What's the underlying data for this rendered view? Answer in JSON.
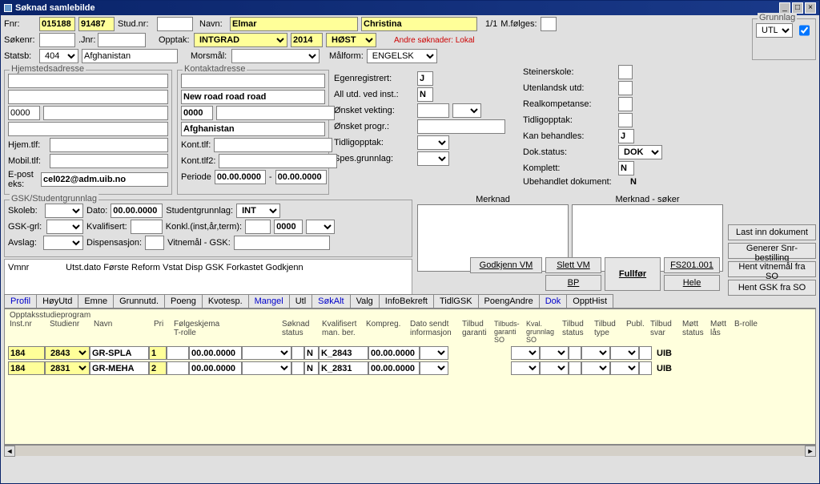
{
  "window_title": "Søknad samlebilde",
  "header": {
    "fnr_label": "Fnr:",
    "fnr1": "015188",
    "fnr2": "91487",
    "studnr_label": "Stud.nr:",
    "studnr": "",
    "navn_label": "Navn:",
    "navn_first": "Elmar",
    "navn_last": "Christina",
    "count": "1/1",
    "mfolges_label": "M.følges:",
    "mfolges": "",
    "sokenr_label": "Søkenr:",
    "sokenr": "",
    "jnr_label": ".Jnr:",
    "jnr": "",
    "opptak_label": "Opptak:",
    "opptak": "INTGRAD",
    "opptak_year": "2014",
    "opptak_sem": "HØST",
    "andre_soknader": "Andre søknader: Lokal",
    "statsb_label": "Statsb:",
    "statsb_code": "404",
    "statsb_name": "Afghanistan",
    "morsmal_label": "Morsmål:",
    "morsmal": "",
    "malform_label": "Målform:",
    "malform": "ENGELSK"
  },
  "grunnlag": {
    "title": "Grunnlag",
    "value": "UTL",
    "checked": true
  },
  "hjemsted": {
    "title": "Hjemstedsadresse",
    "line1": "",
    "line2": "",
    "zip": "0000",
    "city": "",
    "country": "",
    "hjemtlf_label": "Hjem.tlf:",
    "hjemtlf": "",
    "mobiltlf_label": "Mobil.tlf:",
    "mobiltlf": "",
    "epost_label": "E-post eks:",
    "epost": "cel022@adm.uib.no"
  },
  "kontakt": {
    "title": "Kontaktadresse",
    "line1": "",
    "line2": "New road road road",
    "zip": "0000",
    "city": "",
    "country": "Afghanistan",
    "konttlf_label": "Kont.tlf:",
    "konttlf": "",
    "konttlf2_label": "Kont.tlf2:",
    "konttlf2": "",
    "periode_label": "Periode",
    "periode_from": "00.00.0000",
    "periode_to": "00.00.0000"
  },
  "mid": {
    "egenregistrert_label": "Egenregistrert:",
    "egenregistrert": "J",
    "allutd_label": "All utd. ved inst.:",
    "allutd": "N",
    "onsket_vekting_label": "Ønsket vekting:",
    "onsket_vekting": "",
    "onsket_progr_label": "Ønsket progr.:",
    "onsket_progr": "",
    "tidligopptak_label": "Tidligopptak:",
    "tidligopptak": "",
    "spesgrunnlag_label": "Spes.grunnlag:",
    "spesgrunnlag": "",
    "steinerskole_label": "Steinerskole:",
    "steinerskole": "",
    "utenlandsk_label": "Utenlandsk utd:",
    "utenlandsk": "",
    "realkompetanse_label": "Realkompetanse:",
    "realkompetanse": "",
    "tidligopptak2_label": "Tidligopptak:",
    "tidligopptak2": "",
    "kanbehandles_label": "Kan behandles:",
    "kanbehandles": "J",
    "dokstatus_label": "Dok.status:",
    "dokstatus": "DOK",
    "komplett_label": "Komplett:",
    "komplett": "N",
    "ubehandlet_label": "Ubehandlet dokument:",
    "ubehandlet": "N"
  },
  "gsk": {
    "title": "GSK/Studentgrunnlag",
    "skoleb_label": "Skoleb:",
    "dato_label": "Dato:",
    "dato": "00.00.0000",
    "studentgrunnlag_label": "Studentgrunnlag:",
    "studentgrunnlag": "INT",
    "gskgrl_label": "GSK-grl:",
    "kvalifisert_label": "Kvalifisert:",
    "kvalifisert": "",
    "konkl_label": "Konkl.(inst,år,term):",
    "konkl_val": "0000",
    "avslag_label": "Avslag:",
    "dispensasjon_label": "Dispensasjon:",
    "dispensasjon": "",
    "vitnemal_label": "Vitnemål - GSK:"
  },
  "merknad_title": "Merknad",
  "merknad_soker_title": "Merknad - søker",
  "vmnr_header": "Vmnr               Utst.dato Første Reform Vstat Disp GSK Forkastet Godkjenn",
  "buttons": {
    "slett_vm": "Slett VM",
    "bp": "BP",
    "fullfor": "Fullfør",
    "godkjenn_vm": "Godkjenn VM",
    "fs201": "FS201.001",
    "hele": "Hele",
    "last_inn": "Last inn dokument",
    "generer": "Generer Snr-bestilling",
    "hent_vitnemal": "Hent vitnemål fra SO",
    "hent_gsk": "Hent GSK fra SO"
  },
  "tabs": [
    "Profil",
    "HøyUtd",
    "Emne",
    "Grunnutd.",
    "Poeng",
    "Kvotesp.",
    "Mangel",
    "Utl",
    "SøkAlt",
    "Valg",
    "InfoBekreft",
    "TidlGSK",
    "PoengAndre",
    "Dok",
    "OpptHist"
  ],
  "tabs_blue": [
    "Profil",
    "Mangel",
    "SøkAlt",
    "Dok"
  ],
  "grid_headers": {
    "opptaksstudieprogram": "Opptaksstudieprogram",
    "instnr": "Inst.nr",
    "studienr": "Studienr",
    "navn": "Navn",
    "pri": "Pri",
    "folgeskjema": "Følgeskjema",
    "trolle": "T-rolle",
    "soknad": "Søknad",
    "status": "status",
    "kvalifisert": "Kvalifisert",
    "manber": "man. ber.",
    "kompreg": "Kompreg.",
    "datosendt": "Dato sendt",
    "informasjon": "informasjon",
    "tilbud": "Tilbud",
    "garanti": "garanti",
    "tilbuds_garanti_so": "Tilbuds-",
    "garanti_so": "garanti",
    "so": "SO",
    "kval": "Kval.",
    "grunnlag": "grunnlag",
    "tilbud_status": "Tilbud",
    "tilbud_type": "Tilbud",
    "status2": "status",
    "type": "type",
    "publ": "Publ.",
    "svar": "svar",
    "mott": "Møtt",
    "status3": "status",
    "las": "lås",
    "brolle": "B-rolle"
  },
  "grid_rows": [
    {
      "inst": "184",
      "studienr": "2843",
      "navn": "GR-SPLA",
      "pri": "1",
      "trolle": "",
      "dato": "00.00.0000",
      "status": "",
      "man": "",
      "ber": "N",
      "kompreg": "K_2843",
      "datosendt": "00.00.0000",
      "brolle": "UIB"
    },
    {
      "inst": "184",
      "studienr": "2831",
      "navn": "GR-MEHA",
      "pri": "2",
      "trolle": "",
      "dato": "00.00.0000",
      "status": "",
      "man": "",
      "ber": "N",
      "kompreg": "K_2831",
      "datosendt": "00.00.0000",
      "brolle": "UIB"
    }
  ]
}
